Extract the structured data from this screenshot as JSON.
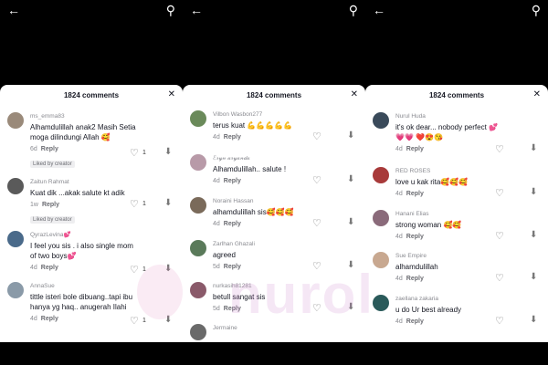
{
  "header": {
    "comments_title": "1824 comments"
  },
  "panels": [
    {
      "comments": [
        {
          "user": "ms_emma83",
          "text": "Alhamdulillah anak2 Masih Setia moga dilindungi Allah 🥰",
          "age": "6d",
          "reply": "Reply",
          "likes": "1",
          "liked_by_creator": "Liked by creator",
          "avatar_color": "#9a8a7a"
        },
        {
          "user": "Zaitun Rahmat",
          "text": "Kuat dik ...akak salute kt adik",
          "age": "1w",
          "reply": "Reply",
          "likes": "1",
          "liked_by_creator": "Liked by creator",
          "avatar_color": "#5a5a5a"
        },
        {
          "user": "QyrazLevina💕",
          "text": "I feel you sis . i also single mom of two boys💕",
          "age": "4d",
          "reply": "Reply",
          "likes": "1",
          "liked_by_creator": "",
          "avatar_color": "#4a6a8a"
        },
        {
          "user": "AnnaSue",
          "text": "tittle isteri bole dibuang..tapi ibu hanya yg haq.. anugerah Ilahi",
          "age": "4d",
          "reply": "Reply",
          "likes": "1",
          "liked_by_creator": "",
          "avatar_color": "#8a9aa8"
        }
      ]
    },
    {
      "comments": [
        {
          "user": "Vilbon Wasbon277",
          "text": "terus kuat 💪💪💪💪💪",
          "age": "4d",
          "reply": "Reply",
          "likes": "",
          "liked_by_creator": "",
          "avatar_color": "#6a8a5a"
        },
        {
          "user": "ℰ𝓇𝓎𝓃 𝒶𝓇𝓎𝒶𝓃𝒹𝒶",
          "text": "Alhamdulillah.. salute !",
          "age": "4d",
          "reply": "Reply",
          "likes": "",
          "liked_by_creator": "",
          "avatar_color": "#b89aa8"
        },
        {
          "user": "Noraini Hassan",
          "text": "alhamdulillah sis🥰🥰🥰",
          "age": "4d",
          "reply": "Reply",
          "likes": "",
          "liked_by_creator": "",
          "avatar_color": "#7a6a5a"
        },
        {
          "user": "Zarlhan Ghazali",
          "text": "agreed",
          "age": "5d",
          "reply": "Reply",
          "likes": "",
          "liked_by_creator": "",
          "avatar_color": "#5a7a5a"
        },
        {
          "user": "nurkasih81281",
          "text": "betull sangat sis",
          "age": "5d",
          "reply": "Reply",
          "likes": "",
          "liked_by_creator": "",
          "avatar_color": "#8a5a6a"
        },
        {
          "user": "Jermaine",
          "text": "",
          "age": "",
          "reply": "",
          "likes": "",
          "liked_by_creator": "",
          "avatar_color": "#6a6a6a"
        }
      ]
    },
    {
      "comments": [
        {
          "user": "Nurul Huda",
          "text": "it's ok dear... nobody perfect 💕💗💗 ❤️😍😘",
          "age": "4d",
          "reply": "Reply",
          "likes": "",
          "liked_by_creator": "",
          "avatar_color": "#3a4a5a"
        },
        {
          "user": "RED ROSES",
          "text": "love u kak rita🥰🥰🥰",
          "age": "4d",
          "reply": "Reply",
          "likes": "",
          "liked_by_creator": "",
          "avatar_color": "#a83a3a"
        },
        {
          "user": "Hanani Elias",
          "text": "strong woman 🥰🥰",
          "age": "4d",
          "reply": "Reply",
          "likes": "",
          "liked_by_creator": "",
          "avatar_color": "#8a6a7a"
        },
        {
          "user": "Sue Empire",
          "text": "alhamdulillah",
          "age": "4d",
          "reply": "Reply",
          "likes": "",
          "liked_by_creator": "",
          "avatar_color": "#c8a890"
        },
        {
          "user": "zaellana zakaria",
          "text": "u do Ur best already",
          "age": "4d",
          "reply": "Reply",
          "likes": "",
          "liked_by_creator": "",
          "avatar_color": "#2a5a5a"
        }
      ]
    }
  ],
  "watermark": "nurol"
}
